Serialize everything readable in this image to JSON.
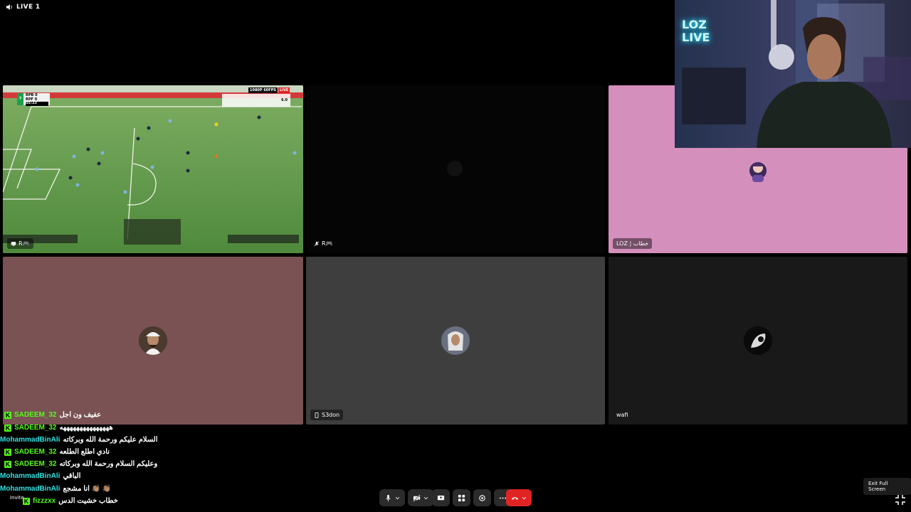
{
  "header": {
    "live_label": "LIVE 1"
  },
  "tiles": {
    "game": {
      "name": "R🎮"
    },
    "dark": {
      "name": "R🎮"
    },
    "pink": {
      "name": "LOZ | خطاب"
    },
    "rose": {
      "name": ""
    },
    "s3don": {
      "name": "S3don"
    },
    "wafi": {
      "name": "wafi"
    }
  },
  "scoreboard": {
    "rank": "7",
    "team1": "RPB",
    "team2": "RPF",
    "score1": "0",
    "score2": "0",
    "time": "05:33",
    "quality_badge": "1080P 60FPS",
    "live_badge": "LIVE",
    "rating": "6.0"
  },
  "chat": [
    {
      "user": "SADEEM_32",
      "message": "عفيف ون اجل",
      "badge": "K",
      "color": "green"
    },
    {
      "user": "SADEEM_32",
      "message": "هههههههههههههههه",
      "badge": "K",
      "color": "green"
    },
    {
      "user": "MohammadBinAli",
      "message": "السلام عليكم ورحمة الله وبركاته",
      "badge": "",
      "color": "blue"
    },
    {
      "user": "SADEEM_32",
      "message": "نادي اطلع الطلعه",
      "badge": "K",
      "color": "green"
    },
    {
      "user": "SADEEM_32",
      "message": "وعليكم السلام ورحمة الله وبركاته",
      "badge": "K",
      "color": "green"
    },
    {
      "user": "MohammadBinAli",
      "message": "الباقي",
      "badge": "",
      "color": "blue"
    },
    {
      "user": "MohammadBinAli",
      "message": "انا مشجع 👏🏽 👏🏽",
      "badge": "",
      "color": "blue"
    },
    {
      "user": "fizzzxx",
      "message": "خطاب خشيت الدس",
      "badge": "K",
      "color": "green"
    }
  ],
  "controls": {
    "invite_label": "Invite",
    "exit_fullscreen_tooltip": "Exit Full Screen"
  },
  "webcam": {
    "sign_text": "LOZ LIVE"
  },
  "colors": {
    "pink_tile": "#d58fbc",
    "rose_tile": "#7a5254",
    "grey_tile": "#3f3e3f",
    "dark_tile": "#191919",
    "kick_green": "#53fc18",
    "end_call": "#e02424"
  }
}
